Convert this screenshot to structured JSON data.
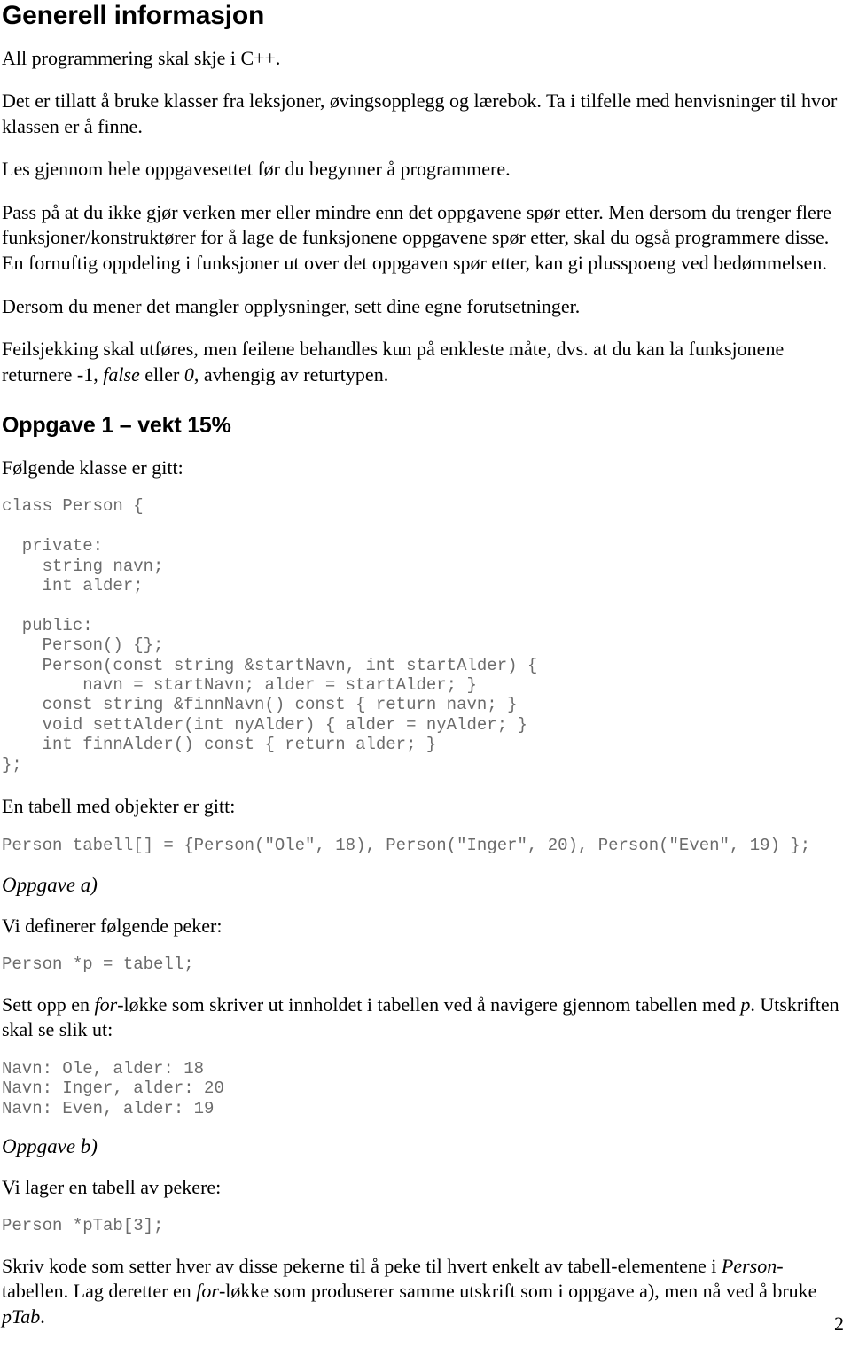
{
  "document": {
    "title": "Generell informasjon",
    "page_number": "2"
  },
  "intro": {
    "p1": "All programmering skal skje i C++.",
    "p2": "Det er tillatt å bruke klasser fra leksjoner, øvingsopplegg og lærebok. Ta i tilfelle med henvisninger til hvor klassen er å finne.",
    "p3": "Les gjennom hele oppgavesettet før du begynner å programmere.",
    "p4": "Pass på at du ikke gjør verken mer eller mindre enn det oppgavene spør etter. Men dersom du trenger flere funksjoner/konstruktører for å lage de funksjonene oppgavene spør etter, skal du også programmere disse. En fornuftig oppdeling i funksjoner ut over det oppgaven spør etter, kan gi plusspoeng ved bedømmelsen.",
    "p5": "Dersom du mener det mangler opplysninger, sett dine egne forutsetninger.",
    "p6_part1": "Feilsjekking skal utføres, men feilene behandles kun på enkleste måte, dvs. at du kan la funksjonene returnere -1, ",
    "p6_em1": "false",
    "p6_part2": " eller ",
    "p6_em2": "0",
    "p6_part3": ", avhengig av returtypen."
  },
  "task1": {
    "heading": "Oppgave 1 – vekt 15%",
    "lead": "Følgende klasse er gitt:",
    "class_code": "class Person {\n\n  private:\n    string navn;\n    int alder;\n\n  public:\n    Person() {};\n    Person(const string &startNavn, int startAlder) {\n        navn = startNavn; alder = startAlder; }\n    const string &finnNavn() const { return navn; }\n    void settAlder(int nyAlder) { alder = nyAlder; }\n    int finnAlder() const { return alder; }\n};",
    "table_lead": "En tabell med objekter er gitt:",
    "table_code": "Person tabell[] = {Person(\"Ole\", 18), Person(\"Inger\", 20), Person(\"Even\", 19) };"
  },
  "task_a": {
    "label": "Oppgave a)",
    "lead": "Vi definerer følgende peker:",
    "code": "Person *p = tabell;",
    "instruction_part1": "Sett opp en ",
    "instruction_em1": "for",
    "instruction_part2": "-løkke som skriver ut innholdet i tabellen ved å navigere gjennom tabellen med ",
    "instruction_em2": "p",
    "instruction_part3": ". Utskriften skal se slik ut:",
    "output_code": "Navn: Ole, alder: 18\nNavn: Inger, alder: 20\nNavn: Even, alder: 19"
  },
  "task_b": {
    "label": "Oppgave b)",
    "lead": "Vi lager en tabell av pekere:",
    "code": "Person *pTab[3];",
    "instruction_part1": "Skriv kode som setter hver av disse pekerne til å peke til hvert enkelt av tabell-elementene i ",
    "instruction_em1": "Person",
    "instruction_part2": "-tabellen. Lag deretter en ",
    "instruction_em2": "for",
    "instruction_part3": "-løkke som produserer samme utskrift som i oppgave a), men nå ved å bruke ",
    "instruction_em3": "pTab",
    "instruction_part4": "."
  }
}
